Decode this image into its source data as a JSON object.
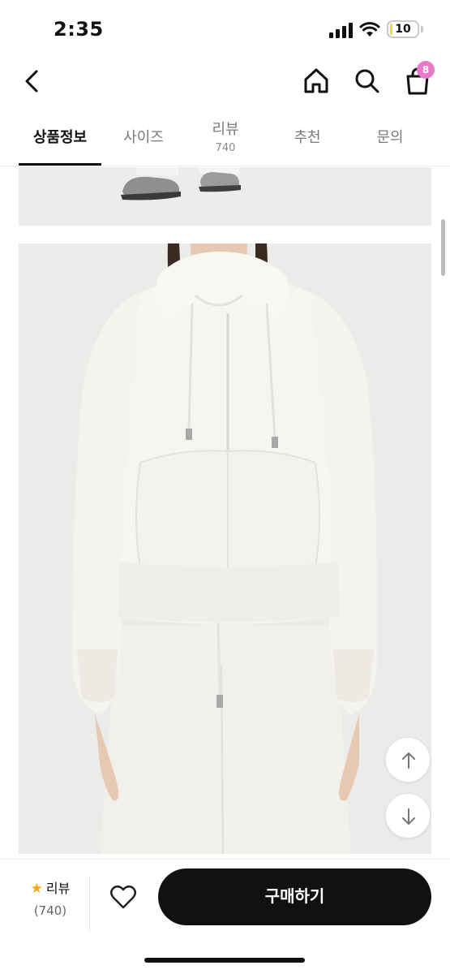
{
  "status_bar": {
    "time": "2:35",
    "battery_level": "10",
    "battery_fraction": 0.1,
    "battery_color": "#f6d64a"
  },
  "header": {
    "back_icon": "chevron-left-icon",
    "home_icon": "home-icon",
    "search_icon": "search-icon",
    "cart_icon": "shopping-bag-icon",
    "cart_badge": "8",
    "cart_badge_color": "#e879c9"
  },
  "tabs": [
    {
      "label": "상품정보",
      "count": "",
      "active": true
    },
    {
      "label": "사이즈",
      "count": ""
    },
    {
      "label": "리뷰",
      "count": "740"
    },
    {
      "label": "추천",
      "count": ""
    },
    {
      "label": "문의",
      "count": ""
    }
  ],
  "floating_buttons": {
    "up_icon": "arrow-up-icon",
    "down_icon": "arrow-down-icon"
  },
  "bottom_bar": {
    "review_star_icon": "star-icon",
    "review_label": "리뷰",
    "review_count": "(740)",
    "wishlist_icon": "heart-icon",
    "buy_label": "구매하기",
    "accent_color": "#111111",
    "star_color": "#f5a623"
  }
}
